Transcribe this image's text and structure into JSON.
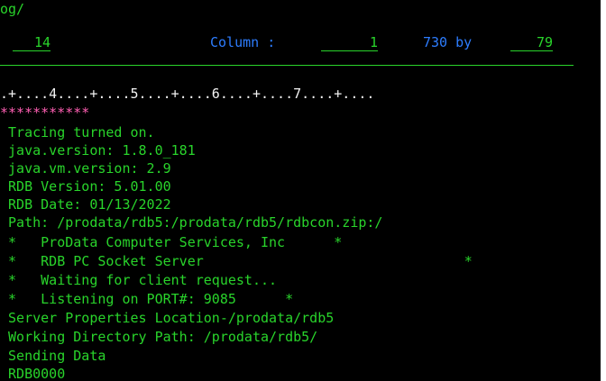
{
  "header": {
    "path_fragment": "og/",
    "record_value": "14",
    "column_label": "Column :",
    "column_value": "1",
    "size_text": "730 by",
    "width_value": "79"
  },
  "ruler": ".+....4....+....5....+....6....+....7....+....",
  "stars": "***********",
  "lines": [
    " Tracing turned on.",
    " java.version: 1.8.0_181",
    " java.vm.version: 2.9",
    " RDB Version: 5.01.00",
    " RDB Date: 01/13/2022",
    " Path: /prodata/rdb5:/prodata/rdb5/rdbcon.zip:/",
    " *   ProData Computer Services, Inc      *",
    " *   RDB PC Socket Server                                *",
    " *   Waiting for client request...",
    " *   Listening on PORT#: 9085      *",
    " Server Properties Location-/prodata/rdb5",
    " Working Directory Path: /prodata/rdb5/",
    " Sending Data",
    " RDB0000"
  ]
}
